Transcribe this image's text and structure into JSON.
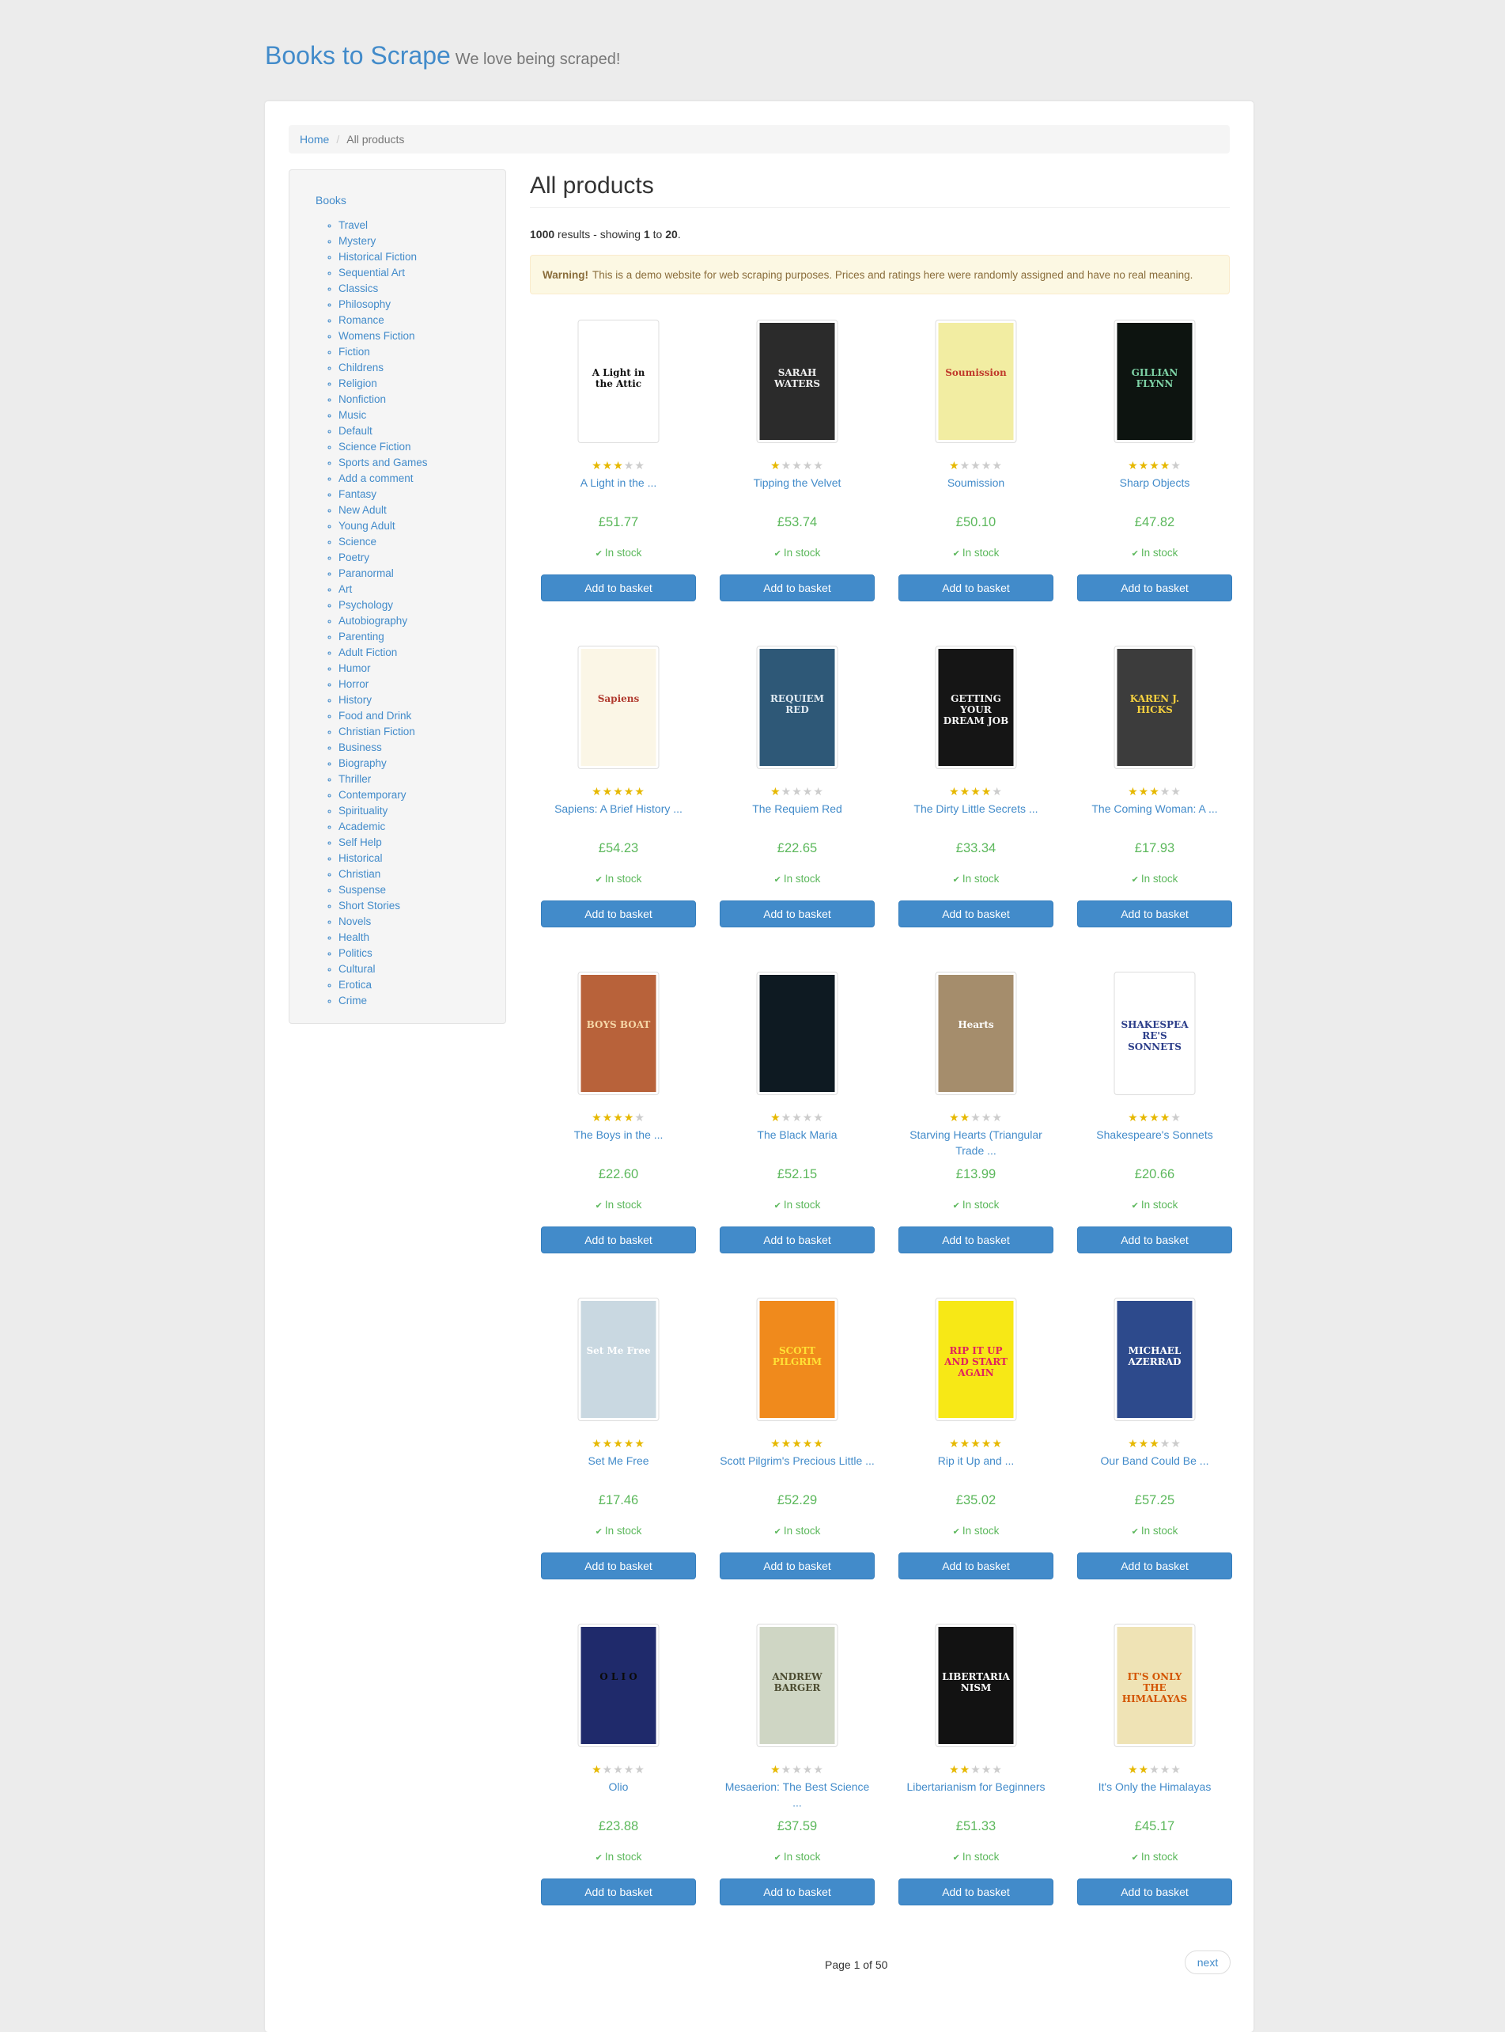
{
  "header": {
    "brand": "Books to Scrape",
    "tagline": "We love being scraped!"
  },
  "breadcrumb": {
    "home": "Home",
    "current": "All products"
  },
  "sidebar": {
    "root": "Books",
    "categories": [
      "Travel",
      "Mystery",
      "Historical Fiction",
      "Sequential Art",
      "Classics",
      "Philosophy",
      "Romance",
      "Womens Fiction",
      "Fiction",
      "Childrens",
      "Religion",
      "Nonfiction",
      "Music",
      "Default",
      "Science Fiction",
      "Sports and Games",
      "Add a comment",
      "Fantasy",
      "New Adult",
      "Young Adult",
      "Science",
      "Poetry",
      "Paranormal",
      "Art",
      "Psychology",
      "Autobiography",
      "Parenting",
      "Adult Fiction",
      "Humor",
      "Horror",
      "History",
      "Food and Drink",
      "Christian Fiction",
      "Business",
      "Biography",
      "Thriller",
      "Contemporary",
      "Spirituality",
      "Academic",
      "Self Help",
      "Historical",
      "Christian",
      "Suspense",
      "Short Stories",
      "Novels",
      "Health",
      "Politics",
      "Cultural",
      "Erotica",
      "Crime"
    ]
  },
  "main": {
    "title": "All products",
    "results_count": "1000",
    "results_text1": " results - showing ",
    "results_from": "1",
    "results_text2": " to ",
    "results_to": "20",
    "results_end": ".",
    "warning_label": "Warning!",
    "warning_text": "This is a demo website for web scraping purposes. Prices and ratings here were randomly assigned and have no real meaning."
  },
  "products": [
    {
      "title": "A Light in the ...",
      "price": "£51.77",
      "rating": 3,
      "stock": "In stock",
      "button": "Add to basket",
      "cover_bg": "#ffffff",
      "cover_fg": "#111111",
      "cover_text": "A Light in the Attic"
    },
    {
      "title": "Tipping the Velvet",
      "price": "£53.74",
      "rating": 1,
      "stock": "In stock",
      "button": "Add to basket",
      "cover_bg": "#2b2b2b",
      "cover_fg": "#eeeeee",
      "cover_text": "SARAH WATERS"
    },
    {
      "title": "Soumission",
      "price": "£50.10",
      "rating": 1,
      "stock": "In stock",
      "button": "Add to basket",
      "cover_bg": "#f2eda2",
      "cover_fg": "#c0392b",
      "cover_text": "Soumission"
    },
    {
      "title": "Sharp Objects",
      "price": "£47.82",
      "rating": 4,
      "stock": "In stock",
      "button": "Add to basket",
      "cover_bg": "#0d1410",
      "cover_fg": "#7ed3a6",
      "cover_text": "GILLIAN FLYNN"
    },
    {
      "title": "Sapiens: A Brief History ...",
      "price": "£54.23",
      "rating": 5,
      "stock": "In stock",
      "button": "Add to basket",
      "cover_bg": "#fbf6e6",
      "cover_fg": "#b03a2e",
      "cover_text": "Sapiens"
    },
    {
      "title": "The Requiem Red",
      "price": "£22.65",
      "rating": 1,
      "stock": "In stock",
      "button": "Add to basket",
      "cover_bg": "#2e5877",
      "cover_fg": "#dfe9f1",
      "cover_text": "REQUIEM RED"
    },
    {
      "title": "The Dirty Little Secrets ...",
      "price": "£33.34",
      "rating": 4,
      "stock": "In stock",
      "button": "Add to basket",
      "cover_bg": "#151515",
      "cover_fg": "#f1f1f1",
      "cover_text": "GETTING YOUR DREAM JOB"
    },
    {
      "title": "The Coming Woman: A ...",
      "price": "£17.93",
      "rating": 3,
      "stock": "In stock",
      "button": "Add to basket",
      "cover_bg": "#3c3c3c",
      "cover_fg": "#f4d03f",
      "cover_text": "KAREN J. HICKS"
    },
    {
      "title": "The Boys in the ...",
      "price": "£22.60",
      "rating": 4,
      "stock": "In stock",
      "button": "Add to basket",
      "cover_bg": "#b8623a",
      "cover_fg": "#f6d7a7",
      "cover_text": "BOYS BOAT"
    },
    {
      "title": "The Black Maria",
      "price": "£52.15",
      "rating": 1,
      "stock": "In stock",
      "button": "Add to basket",
      "cover_bg": "#0e1a22",
      "cover_fg": "#4a6272",
      "cover_text": ""
    },
    {
      "title": "Starving Hearts (Triangular Trade ...",
      "price": "£13.99",
      "rating": 2,
      "stock": "In stock",
      "button": "Add to basket",
      "cover_bg": "#a58d6c",
      "cover_fg": "#ffffff",
      "cover_text": "Hearts"
    },
    {
      "title": "Shakespeare's Sonnets",
      "price": "£20.66",
      "rating": 4,
      "stock": "In stock",
      "button": "Add to basket",
      "cover_bg": "#ffffff",
      "cover_fg": "#2c3e8a",
      "cover_text": "SHAKESPEARE'S SONNETS"
    },
    {
      "title": "Set Me Free",
      "price": "£17.46",
      "rating": 5,
      "stock": "In stock",
      "button": "Add to basket",
      "cover_bg": "#c9d8e1",
      "cover_fg": "#ffffff",
      "cover_text": "Set Me Free"
    },
    {
      "title": "Scott Pilgrim's Precious Little ...",
      "price": "£52.29",
      "rating": 5,
      "stock": "In stock",
      "button": "Add to basket",
      "cover_bg": "#f08a1c",
      "cover_fg": "#ffe135",
      "cover_text": "SCOTT PILGRIM"
    },
    {
      "title": "Rip it Up and ...",
      "price": "£35.02",
      "rating": 5,
      "stock": "In stock",
      "button": "Add to basket",
      "cover_bg": "#f7e816",
      "cover_fg": "#e0245e",
      "cover_text": "RIP IT UP AND START AGAIN"
    },
    {
      "title": "Our Band Could Be ...",
      "price": "£57.25",
      "rating": 3,
      "stock": "In stock",
      "button": "Add to basket",
      "cover_bg": "#2d4a8c",
      "cover_fg": "#ffffff",
      "cover_text": "MICHAEL AZERRAD"
    },
    {
      "title": "Olio",
      "price": "£23.88",
      "rating": 1,
      "stock": "In stock",
      "button": "Add to basket",
      "cover_bg": "#1f2a6b",
      "cover_fg": "#0a0a0a",
      "cover_text": "O L I O"
    },
    {
      "title": "Mesaerion: The Best Science ...",
      "price": "£37.59",
      "rating": 1,
      "stock": "In stock",
      "button": "Add to basket",
      "cover_bg": "#cfd6c4",
      "cover_fg": "#4b4b30",
      "cover_text": "ANDREW BARGER"
    },
    {
      "title": "Libertarianism for Beginners",
      "price": "£51.33",
      "rating": 2,
      "stock": "In stock",
      "button": "Add to basket",
      "cover_bg": "#121212",
      "cover_fg": "#ffffff",
      "cover_text": "LIBERTARIANISM"
    },
    {
      "title": "It's Only the Himalayas",
      "price": "£45.17",
      "rating": 2,
      "stock": "In stock",
      "button": "Add to basket",
      "cover_bg": "#efe3b5",
      "cover_fg": "#d35400",
      "cover_text": "IT'S ONLY THE HIMALAYAS"
    }
  ],
  "pager": {
    "current": "Page 1 of 50",
    "next": "next"
  },
  "colors": {
    "link": "#428bca",
    "price": "#5cb85c",
    "star": "#e6b800",
    "button": "#428bca"
  }
}
